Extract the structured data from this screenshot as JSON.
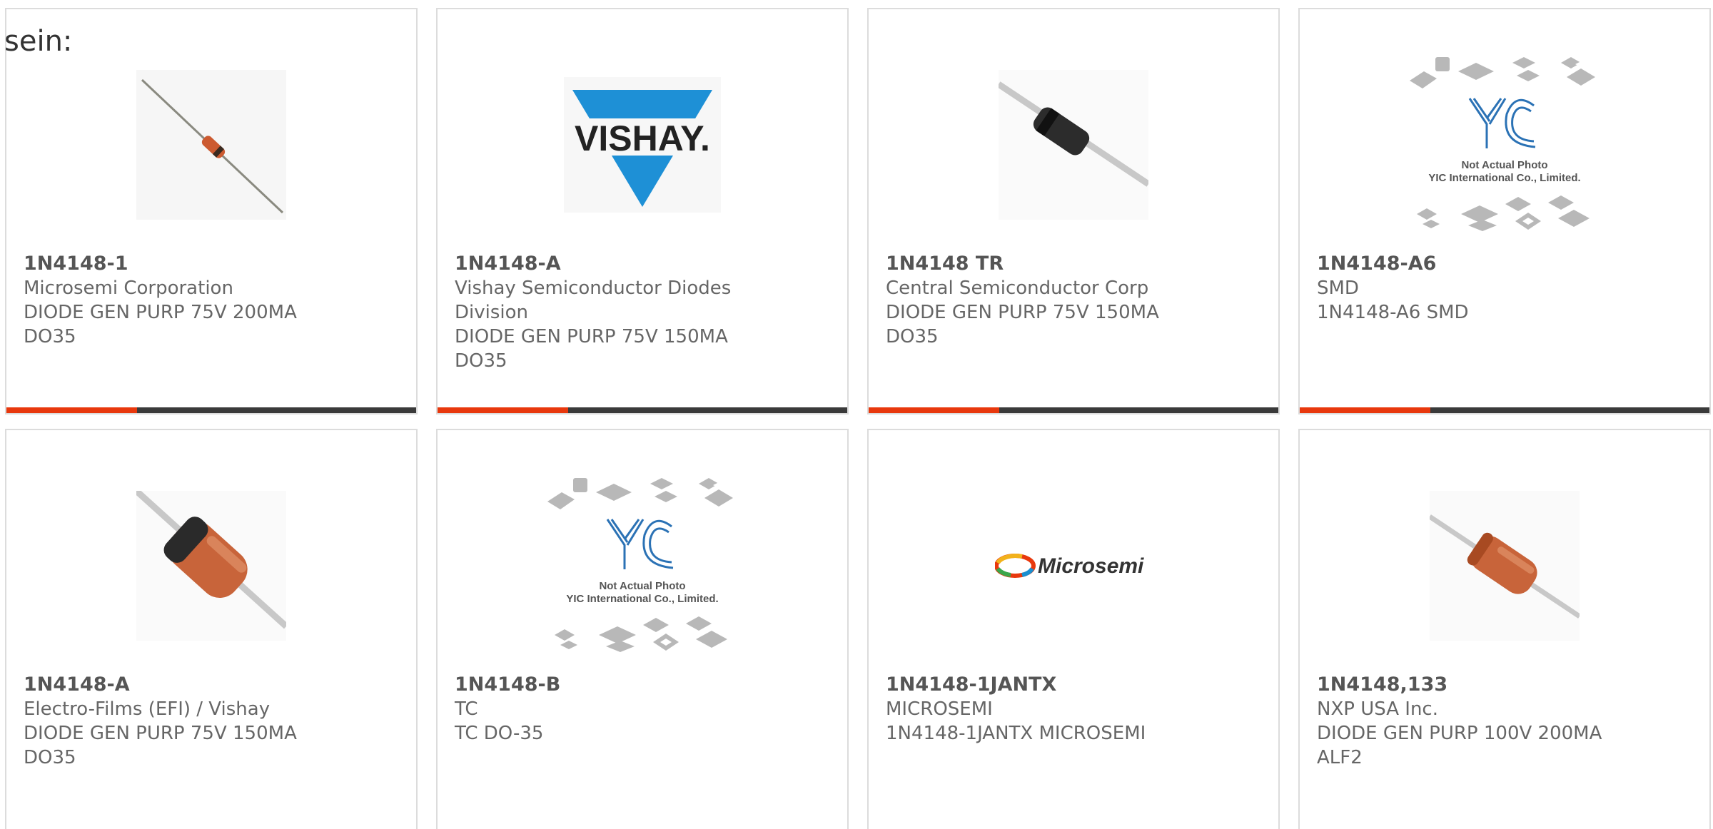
{
  "intro_text": "sein:",
  "colors": {
    "accent": "#e8380d",
    "bar": "#3a3a3a",
    "border": "#dcdcdc",
    "vishay_blue": "#1e90d6",
    "diode_orange": "#c8643a"
  },
  "products": [
    {
      "part_number": "1N4148-1",
      "manufacturer": "Microsemi Corporation",
      "description_1": "DIODE GEN PURP 75V 200MA",
      "description_2": "DO35",
      "image": "small-glass-diode-photo"
    },
    {
      "part_number": "1N4148-A",
      "manufacturer": "Vishay Semiconductor Diodes",
      "description_1": "Division",
      "description_2": "DIODE GEN PURP 75V 150MA",
      "description_3": "DO35",
      "image": "vishay-logo",
      "logo_text": "VISHAY."
    },
    {
      "part_number": "1N4148 TR",
      "manufacturer": "Central Semiconductor Corp",
      "description_1": "DIODE GEN PURP 75V 150MA",
      "description_2": "DO35",
      "image": "black-diode-photo"
    },
    {
      "part_number": "1N4148-A6",
      "manufacturer": "SMD",
      "description_1": "1N4148-A6 SMD",
      "image": "yic-placeholder",
      "placeholder_line_1": "Not Actual Photo",
      "placeholder_line_2": "YIC International Co., Limited."
    },
    {
      "part_number": "1N4148-A",
      "manufacturer": "Electro-Films (EFI) / Vishay",
      "description_1": "DIODE GEN PURP 75V 150MA",
      "description_2": "DO35",
      "image": "orange-diode-photo"
    },
    {
      "part_number": "1N4148-B",
      "manufacturer": "TC",
      "description_1": "TC DO-35",
      "image": "yic-placeholder",
      "placeholder_line_1": "Not Actual Photo",
      "placeholder_line_2": "YIC International Co., Limited."
    },
    {
      "part_number": "1N4148-1JANTX",
      "manufacturer": "MICROSEMI",
      "description_1": "1N4148-1JANTX MICROSEMI",
      "image": "microsemi-logo",
      "logo_text": "Microsemi"
    },
    {
      "part_number": "1N4148,133",
      "manufacturer": "NXP USA Inc.",
      "description_1": "DIODE GEN PURP 100V 200MA",
      "description_2": "ALF2",
      "image": "orange-diode-photo"
    }
  ]
}
